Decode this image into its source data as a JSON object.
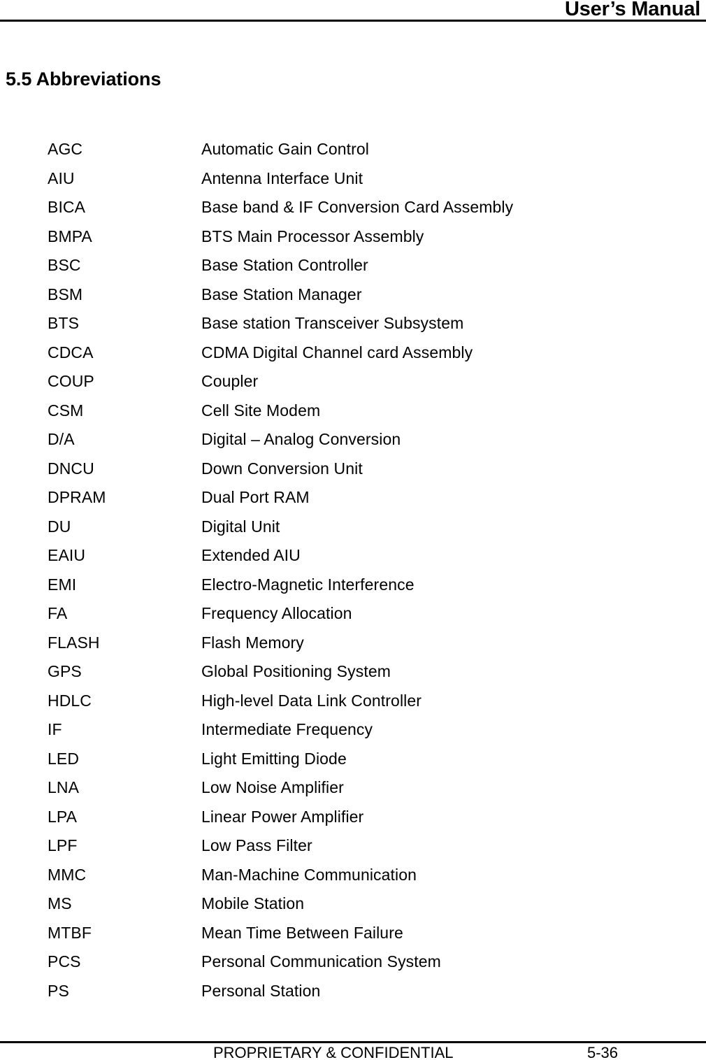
{
  "header": {
    "title": "User’s Manual"
  },
  "section": {
    "heading": "5.5 Abbreviations"
  },
  "abbreviations": [
    {
      "term": "AGC",
      "definition": "Automatic Gain Control"
    },
    {
      "term": "AIU",
      "definition": "Antenna Interface Unit"
    },
    {
      "term": "BICA",
      "definition": "Base band & IF Conversion Card Assembly"
    },
    {
      "term": "BMPA",
      "definition": "BTS Main Processor Assembly"
    },
    {
      "term": "BSC",
      "definition": "Base Station Controller"
    },
    {
      "term": "BSM",
      "definition": "Base Station Manager"
    },
    {
      "term": "BTS",
      "definition": "Base station Transceiver Subsystem"
    },
    {
      "term": "CDCA",
      "definition": "CDMA Digital Channel card Assembly"
    },
    {
      "term": "COUP",
      "definition": "Coupler"
    },
    {
      "term": "CSM",
      "definition": "Cell Site Modem"
    },
    {
      "term": "D/A",
      "definition": "Digital – Analog Conversion"
    },
    {
      "term": "DNCU",
      "definition": "Down Conversion Unit"
    },
    {
      "term": "DPRAM",
      "definition": "Dual Port RAM"
    },
    {
      "term": "DU",
      "definition": "Digital Unit"
    },
    {
      "term": "EAIU",
      "definition": "Extended AIU"
    },
    {
      "term": "EMI",
      "definition": "Electro-Magnetic Interference"
    },
    {
      "term": "FA",
      "definition": "Frequency Allocation"
    },
    {
      "term": "FLASH",
      "definition": "Flash Memory"
    },
    {
      "term": "GPS",
      "definition": "Global Positioning System"
    },
    {
      "term": "HDLC",
      "definition": "High-level Data Link Controller"
    },
    {
      "term": "IF",
      "definition": "Intermediate Frequency"
    },
    {
      "term": "LED",
      "definition": "Light Emitting Diode"
    },
    {
      "term": "LNA",
      "definition": "Low Noise Amplifier"
    },
    {
      "term": "LPA",
      "definition": "Linear Power Amplifier"
    },
    {
      "term": "LPF",
      "definition": "Low Pass Filter"
    },
    {
      "term": "MMC",
      "definition": "Man-Machine Communication"
    },
    {
      "term": "MS",
      "definition": "Mobile Station"
    },
    {
      "term": "MTBF",
      "definition": "Mean Time Between Failure"
    },
    {
      "term": "PCS",
      "definition": "Personal Communication System"
    },
    {
      "term": "PS",
      "definition": "Personal Station"
    }
  ],
  "footer": {
    "confidential": "PROPRIETARY & CONFIDENTIAL",
    "page_number": "5-36"
  }
}
